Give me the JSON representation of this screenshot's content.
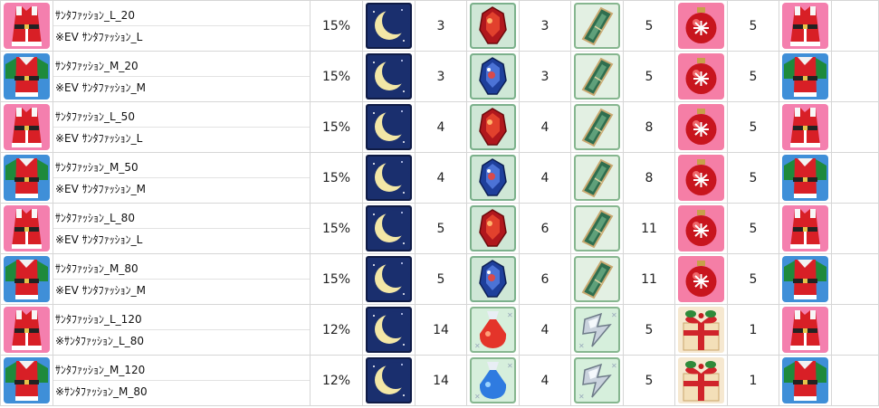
{
  "table": {
    "rows": [
      {
        "outfit": "santa-l-icon",
        "name": "ｻﾝﾀﾌｧｯｼｮﾝ_L_20",
        "source": "※EV ｻﾝﾀﾌｧｯｼｮﾝ_L",
        "rate": "15%",
        "mats": [
          {
            "icon": "moon-icon",
            "qty": "3"
          },
          {
            "icon": "red-gem-icon",
            "qty": "3"
          },
          {
            "icon": "green-card-icon",
            "qty": "5"
          },
          {
            "icon": "ornament-icon",
            "qty": "5"
          }
        ]
      },
      {
        "outfit": "santa-m-icon",
        "name": "ｻﾝﾀﾌｧｯｼｮﾝ_M_20",
        "source": "※EV ｻﾝﾀﾌｧｯｼｮﾝ_M",
        "rate": "15%",
        "mats": [
          {
            "icon": "moon-icon",
            "qty": "3"
          },
          {
            "icon": "blue-gem-icon",
            "qty": "3"
          },
          {
            "icon": "green-card-icon",
            "qty": "5"
          },
          {
            "icon": "ornament-icon",
            "qty": "5"
          }
        ]
      },
      {
        "outfit": "santa-l-icon",
        "name": "ｻﾝﾀﾌｧｯｼｮﾝ_L_50",
        "source": "※EV ｻﾝﾀﾌｧｯｼｮﾝ_L",
        "rate": "15%",
        "mats": [
          {
            "icon": "moon-icon",
            "qty": "4"
          },
          {
            "icon": "red-gem-icon",
            "qty": "4"
          },
          {
            "icon": "green-card-icon",
            "qty": "8"
          },
          {
            "icon": "ornament-icon",
            "qty": "5"
          }
        ]
      },
      {
        "outfit": "santa-m-icon",
        "name": "ｻﾝﾀﾌｧｯｼｮﾝ_M_50",
        "source": "※EV ｻﾝﾀﾌｧｯｼｮﾝ_M",
        "rate": "15%",
        "mats": [
          {
            "icon": "moon-icon",
            "qty": "4"
          },
          {
            "icon": "blue-gem-icon",
            "qty": "4"
          },
          {
            "icon": "green-card-icon",
            "qty": "8"
          },
          {
            "icon": "ornament-icon",
            "qty": "5"
          }
        ]
      },
      {
        "outfit": "santa-l-icon",
        "name": "ｻﾝﾀﾌｧｯｼｮﾝ_L_80",
        "source": "※EV ｻﾝﾀﾌｧｯｼｮﾝ_L",
        "rate": "15%",
        "mats": [
          {
            "icon": "moon-icon",
            "qty": "5"
          },
          {
            "icon": "red-gem-icon",
            "qty": "6"
          },
          {
            "icon": "green-card-icon",
            "qty": "11"
          },
          {
            "icon": "ornament-icon",
            "qty": "5"
          }
        ]
      },
      {
        "outfit": "santa-m-icon",
        "name": "ｻﾝﾀﾌｧｯｼｮﾝ_M_80",
        "source": "※EV ｻﾝﾀﾌｧｯｼｮﾝ_M",
        "rate": "15%",
        "mats": [
          {
            "icon": "moon-icon",
            "qty": "5"
          },
          {
            "icon": "blue-gem-icon",
            "qty": "6"
          },
          {
            "icon": "green-card-icon",
            "qty": "11"
          },
          {
            "icon": "ornament-icon",
            "qty": "5"
          }
        ]
      },
      {
        "outfit": "santa-l-icon",
        "name": "ｻﾝﾀﾌｧｯｼｮﾝ_L_120",
        "source": "※ｻﾝﾀﾌｧｯｼｮﾝ_L_80",
        "rate": "12%",
        "mats": [
          {
            "icon": "moon-icon",
            "qty": "14"
          },
          {
            "icon": "red-sack-icon",
            "qty": "4"
          },
          {
            "icon": "silver-shard-icon",
            "qty": "5"
          },
          {
            "icon": "gift-box-icon",
            "qty": "1"
          }
        ]
      },
      {
        "outfit": "santa-m-icon",
        "name": "ｻﾝﾀﾌｧｯｼｮﾝ_M_120",
        "source": "※ｻﾝﾀﾌｧｯｼｮﾝ_M_80",
        "rate": "12%",
        "mats": [
          {
            "icon": "moon-icon",
            "qty": "14"
          },
          {
            "icon": "blue-sack-icon",
            "qty": "4"
          },
          {
            "icon": "silver-shard-icon",
            "qty": "5"
          },
          {
            "icon": "gift-box-icon",
            "qty": "1"
          }
        ]
      }
    ]
  },
  "colors": {
    "santa_l_bg": "#f47fae",
    "santa_m_bg": "#3f8fd8",
    "moon_bg": "#1a2f6e",
    "card_bg": "#cfe7d6",
    "ornament_bg": "#f57ea6",
    "gift_bg": "#f6e8d0",
    "border": "#d6d6d6"
  }
}
